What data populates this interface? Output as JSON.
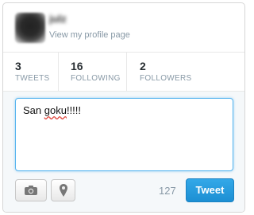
{
  "profile": {
    "name": "julz",
    "link_label": "View my profile page"
  },
  "stats": [
    {
      "value": "3",
      "label": "TWEETS"
    },
    {
      "value": "16",
      "label": "FOLLOWING"
    },
    {
      "value": "2",
      "label": "FOLLOWERS"
    }
  ],
  "compose": {
    "text_before": "San ",
    "text_misspelled": "goku",
    "text_after": "!!!!!",
    "char_count": "127",
    "tweet_label": "Tweet",
    "accent_color": "#1c8fd3"
  },
  "icons": {
    "camera": "camera-icon",
    "location": "location-pin-icon"
  }
}
